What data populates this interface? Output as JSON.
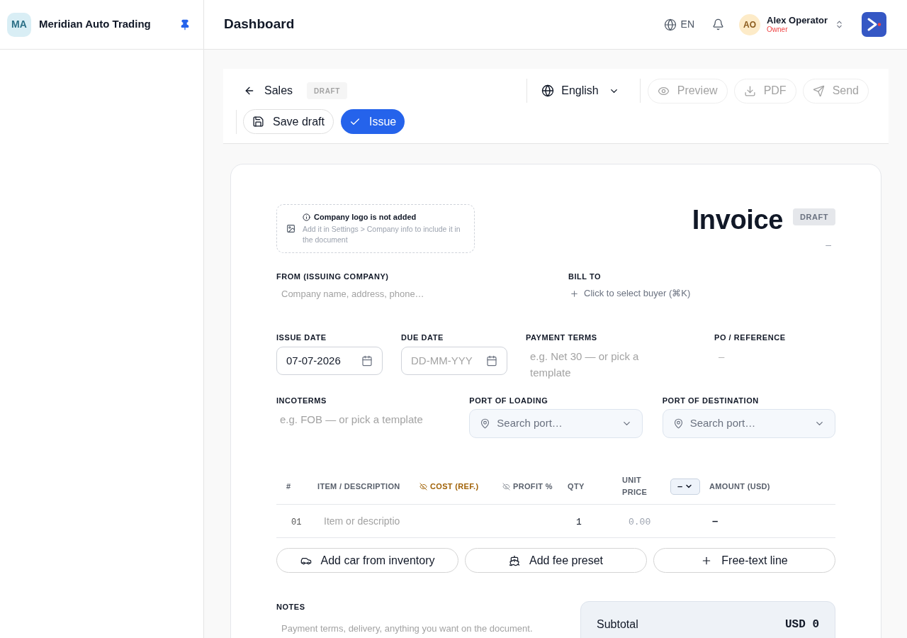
{
  "sidebar": {
    "initials": "MA",
    "company_name": "Meridian Auto Trading",
    "pinned": true
  },
  "header": {
    "title": "Dashboard",
    "language": "EN",
    "user": {
      "initials": "AO",
      "name": "Alex Operator",
      "role": "Owner"
    }
  },
  "toolbar": {
    "back_label": "Sales",
    "status": "DRAFT",
    "language": "English",
    "actions": [
      {
        "kind": "preview",
        "label": "Preview",
        "disabled": true
      },
      {
        "kind": "pdf",
        "label": "PDF",
        "disabled": true
      },
      {
        "kind": "send",
        "label": "Send",
        "disabled": true
      }
    ],
    "draft_actions": [
      {
        "kind": "save",
        "label": "Save draft"
      },
      {
        "kind": "issue",
        "label": "Issue"
      }
    ]
  },
  "document": {
    "logo_notice": {
      "title": "Company logo is not added",
      "text": "Add it in Settings > Company info to include it in the document"
    },
    "title": "Invoice",
    "status": "DRAFT",
    "number": "–",
    "from": {
      "label": "FROM (ISSUING COMPANY)",
      "placeholder": "Company name, address, phone…"
    },
    "bill_to": {
      "label": "BILL TO",
      "action": "Click to select buyer (⌘K)"
    },
    "dates_row": [
      {
        "kind": "date",
        "label": "ISSUE DATE",
        "value": "07-07-2026"
      },
      {
        "kind": "date",
        "label": "DUE DATE",
        "placeholder": "DD-MM-YYY"
      },
      {
        "kind": "textarea",
        "label": "PAYMENT TERMS",
        "placeholder": "e.g. Net 30 — or pick a template"
      },
      {
        "kind": "static",
        "label": "PO / REFERENCE",
        "value": "–"
      }
    ],
    "shipping_row": [
      {
        "kind": "text",
        "label": "INCOTERMS",
        "placeholder": "e.g. FOB — or pick a template"
      },
      {
        "kind": "port",
        "label": "PORT OF LOADING",
        "placeholder": "Search port…"
      },
      {
        "kind": "port",
        "label": "PORT OF DESTINATION",
        "placeholder": "Search port…"
      }
    ],
    "table": {
      "columns": [
        {
          "kind": "plain",
          "label": "#",
          "highlighted": false
        },
        {
          "kind": "plain",
          "label": "ITEM / DESCRIPTION",
          "highlighted": false
        },
        {
          "kind": "internal",
          "label": "COST (REF.)",
          "highlighted": true
        },
        {
          "kind": "internal",
          "label": "PROFIT %",
          "highlighted": false
        },
        {
          "kind": "plain",
          "label": "QTY",
          "highlighted": false
        },
        {
          "kind": "plain",
          "label": "UNIT PRICE",
          "highlighted": false
        },
        {
          "kind": "select",
          "value": "–"
        },
        {
          "kind": "plain",
          "label": "AMOUNT (USD)",
          "highlighted": false
        }
      ],
      "rows": [
        {
          "number": "01",
          "description_placeholder": "Item or descriptio",
          "qty": "1",
          "unit_price": "0.00",
          "amount": "–"
        }
      ]
    },
    "add_buttons": [
      {
        "kind": "car",
        "label": "Add car from inventory"
      },
      {
        "kind": "fee",
        "label": "Add fee preset"
      },
      {
        "kind": "text",
        "label": "Free-text line"
      }
    ],
    "notes": {
      "label": "NOTES",
      "placeholder": "Payment terms, delivery, anything you want on the document."
    },
    "totals": [
      {
        "label": "Subtotal",
        "value": "USD 0"
      }
    ]
  }
}
